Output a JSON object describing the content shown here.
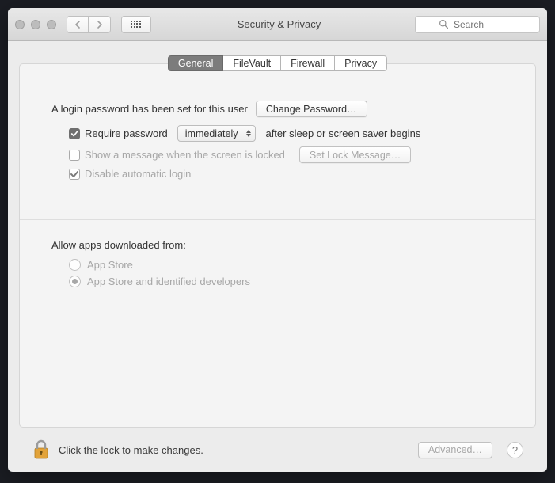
{
  "window": {
    "title": "Security & Privacy"
  },
  "search": {
    "placeholder": "Search"
  },
  "tabs": [
    {
      "label": "General"
    },
    {
      "label": "FileVault"
    },
    {
      "label": "Firewall"
    },
    {
      "label": "Privacy"
    }
  ],
  "login": {
    "text": "A login password has been set for this user",
    "button": "Change Password…"
  },
  "require_pw": {
    "label_pre": "Require password",
    "select": "immediately",
    "label_post": "after sleep or screen saver begins"
  },
  "show_message": {
    "label": "Show a message when the screen is locked",
    "button": "Set Lock Message…"
  },
  "disable_auto_login": {
    "label": "Disable automatic login"
  },
  "allow_apps": {
    "title": "Allow apps downloaded from:",
    "options": [
      "App Store",
      "App Store and identified developers"
    ]
  },
  "footer": {
    "lock_text": "Click the lock to make changes.",
    "advanced": "Advanced…",
    "help": "?"
  }
}
